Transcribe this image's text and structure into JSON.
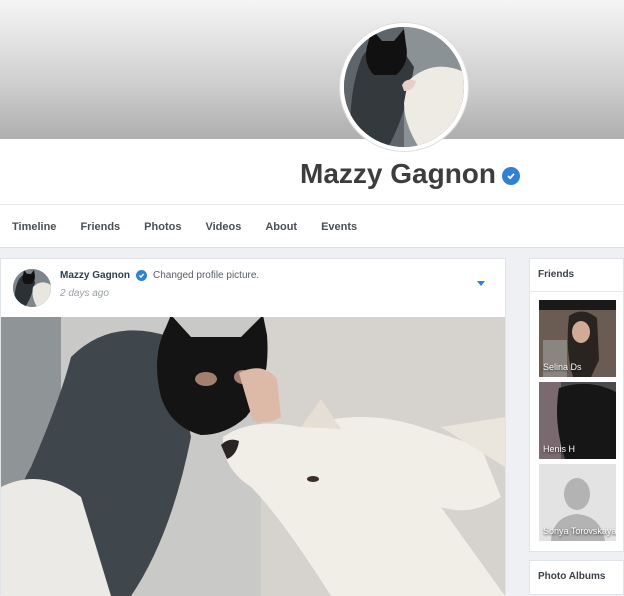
{
  "profile": {
    "name": "Mazzy Gagnon",
    "verified": true
  },
  "nav": {
    "items": [
      "Timeline",
      "Friends",
      "Photos",
      "Videos",
      "About",
      "Events"
    ]
  },
  "post": {
    "author": "Mazzy Gagnon",
    "action": "Changed profile picture.",
    "time": "2 days ago"
  },
  "sidebar": {
    "friends_title": "Friends",
    "friends": [
      {
        "name": "Selina Ds"
      },
      {
        "name": "Henis H"
      },
      {
        "name": "Sonya Torovskaya"
      }
    ],
    "albums_title": "Photo Albums"
  },
  "colors": {
    "accent": "#2f80d6",
    "name_text": "#3d3d3d",
    "page_bg": "#eef0f3"
  }
}
